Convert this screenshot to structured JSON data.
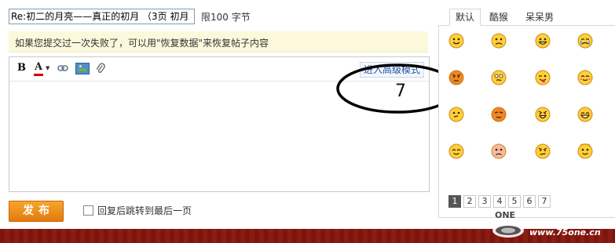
{
  "compose": {
    "subject_value": "Re:初二的月亮——真正的初月 （3页 初月",
    "limit_text": "限100 字节",
    "tip_text": "如果您提交过一次失败了，可以用\"恢复数据\"来恢复帖子内容",
    "submit_label": "发布",
    "jump_label": "回复后跳转到最后一页"
  },
  "toolbar": {
    "bold_label": "B",
    "color_label": "A",
    "advanced_label": "进入高级模式"
  },
  "annotation": {
    "number": "7"
  },
  "emoji_panel": {
    "tabs": [
      "默认",
      "酷猴",
      "呆呆男"
    ],
    "icons": [
      "smile-icon",
      "frown-icon",
      "grin-icon",
      "crying-icon",
      "angry-icon",
      "confused-icon",
      "tongue-icon",
      "blush-icon",
      "thinking-icon",
      "squint-icon",
      "yell-icon",
      "laugh-icon",
      "content-icon",
      "sad-icon",
      "mad-icon",
      "halo-icon"
    ],
    "pages": [
      "1",
      "2",
      "3",
      "4",
      "5",
      "6",
      "7"
    ]
  },
  "watermark": {
    "text": "www.75one.cn",
    "logo_text": "ONE"
  }
}
